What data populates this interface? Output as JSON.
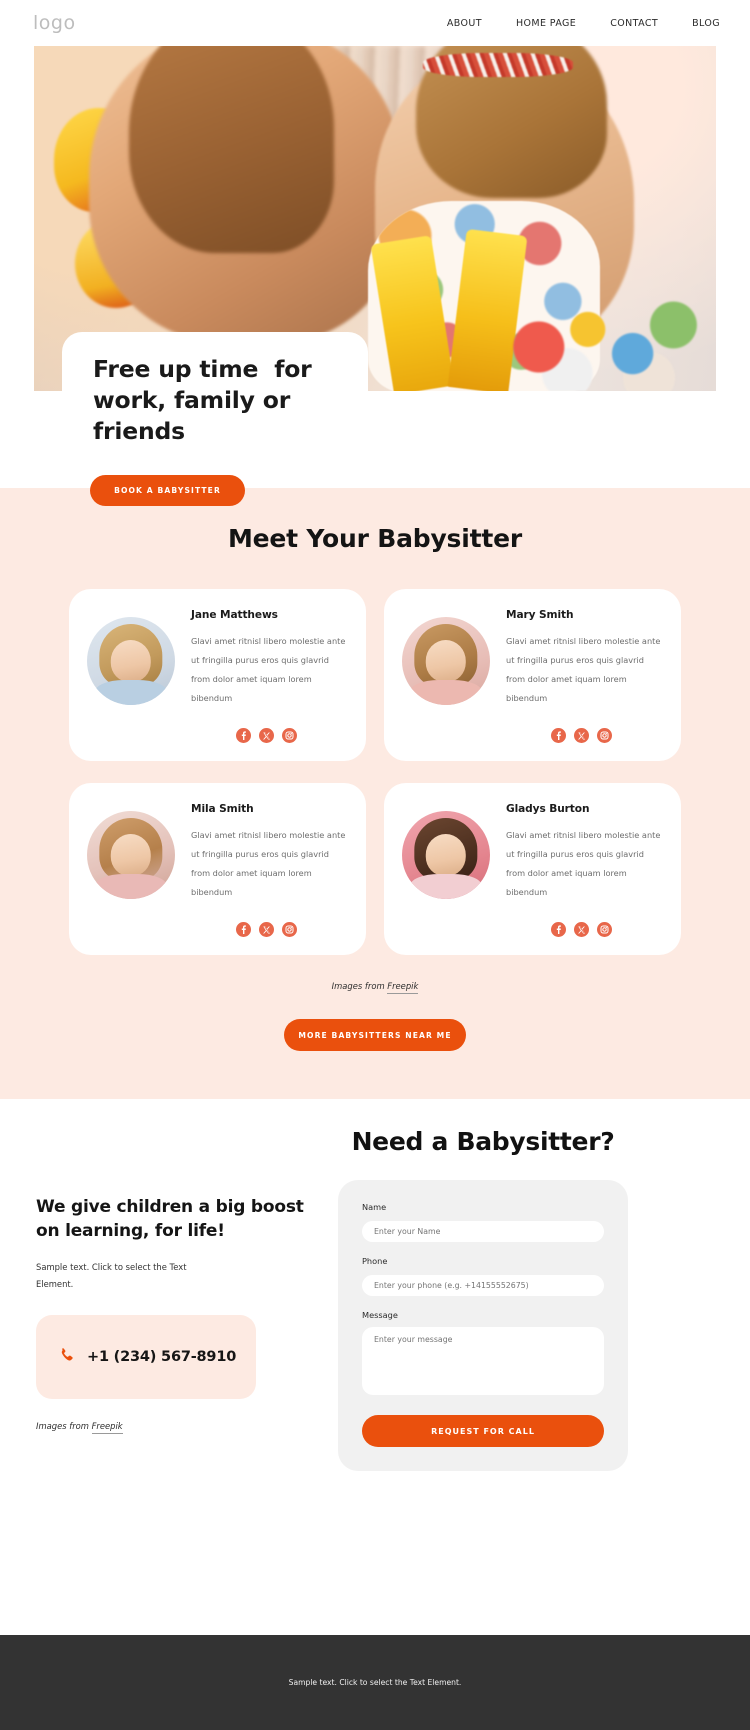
{
  "header": {
    "logo": "logo",
    "nav": [
      {
        "label": "ABOUT"
      },
      {
        "label": "HOME PAGE"
      },
      {
        "label": "CONTACT"
      },
      {
        "label": "BLOG"
      }
    ]
  },
  "hero": {
    "title": "Free up time  for work, family or friends",
    "cta": "BOOK A BABYSITTER",
    "image_alt": "mother and toddler playing with colorful toys"
  },
  "meet": {
    "title": "Meet Your Babysitter",
    "credit_prefix": "Images from ",
    "credit_link": "Freepik",
    "cta": "MORE BABYSITTERS NEAR ME",
    "card_text": "Glavi amet ritnisl libero molestie ante ut fringilla purus eros quis glavrid from dolor amet iquam lorem bibendum",
    "social": [
      {
        "name": "facebook-icon"
      },
      {
        "name": "x-twitter-icon"
      },
      {
        "name": "instagram-icon"
      }
    ],
    "cards": [
      {
        "name": "Jane Matthews"
      },
      {
        "name": "Mary Smith"
      },
      {
        "name": "Mila Smith"
      },
      {
        "name": "Gladys Burton"
      }
    ]
  },
  "contact": {
    "left_title": "We give children a big boost on learning, for life!",
    "left_sub": "Sample text. Click to select the Text Element.",
    "phone": "+1 (234) 567-8910",
    "credit_prefix": "Images from ",
    "credit_link": "Freepik",
    "form_title": "Need a Babysitter?",
    "fields": {
      "name_label": "Name",
      "name_placeholder": "Enter your Name",
      "phone_label": "Phone",
      "phone_placeholder": "Enter your phone (e.g. +14155552675)",
      "message_label": "Message",
      "message_placeholder": "Enter your message"
    },
    "submit": "REQUEST FOR CALL"
  },
  "footer": {
    "text": "Sample text. Click to select the Text Element."
  },
  "colors": {
    "accent": "#ea500d",
    "social": "#e8674a",
    "section_bg": "#fdeae2",
    "form_bg": "#f1f1f1",
    "footer_bg": "#333333"
  }
}
